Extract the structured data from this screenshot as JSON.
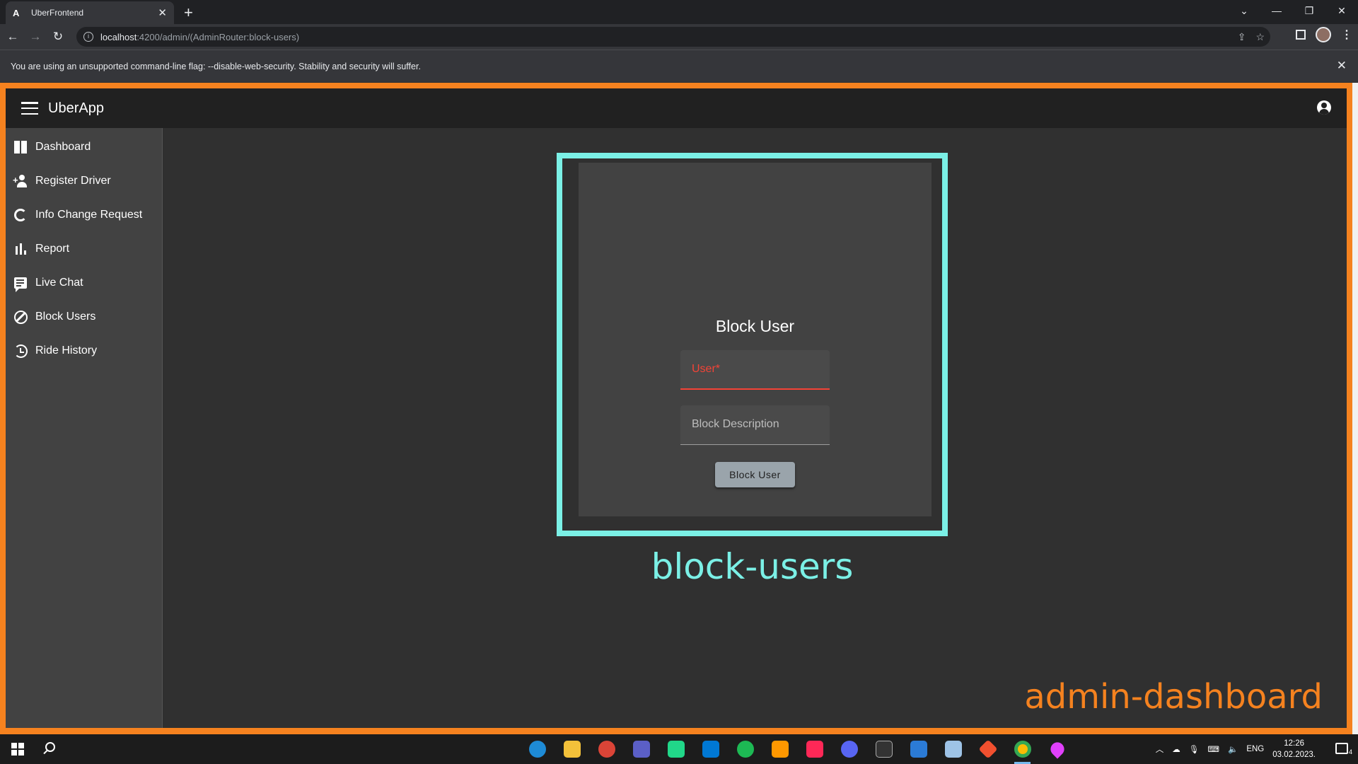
{
  "browser": {
    "tab_title": "UberFrontend",
    "tab_favicon": "A",
    "url_host": "localhost",
    "url_path": ":4200/admin/(AdminRouter:block-users)",
    "infobar_message": "You are using an unsupported command-line flag: --disable-web-security. Stability and security will suffer."
  },
  "app": {
    "title": "UberApp",
    "sidebar": {
      "items": [
        {
          "label": "Dashboard",
          "icon": "dashboard-icon"
        },
        {
          "label": "Register Driver",
          "icon": "person-add-icon"
        },
        {
          "label": "Info Change Request",
          "icon": "loop-icon"
        },
        {
          "label": "Report",
          "icon": "bar-chart-icon"
        },
        {
          "label": "Live Chat",
          "icon": "chat-icon"
        },
        {
          "label": "Block Users",
          "icon": "block-icon"
        },
        {
          "label": "Ride History",
          "icon": "history-icon"
        }
      ]
    },
    "block_form": {
      "title": "Block User",
      "user_label": "User*",
      "description_label": "Block Description",
      "submit_label": "Block User"
    }
  },
  "annotations": {
    "component_label": "block-users",
    "layout_label": "admin-dashboard",
    "colors": {
      "component": "#7bf0e6",
      "layout": "#f5821f"
    }
  },
  "taskbar": {
    "language": "ENG",
    "time": "12:26",
    "date": "03.02.2023.",
    "notification_count": "4"
  }
}
